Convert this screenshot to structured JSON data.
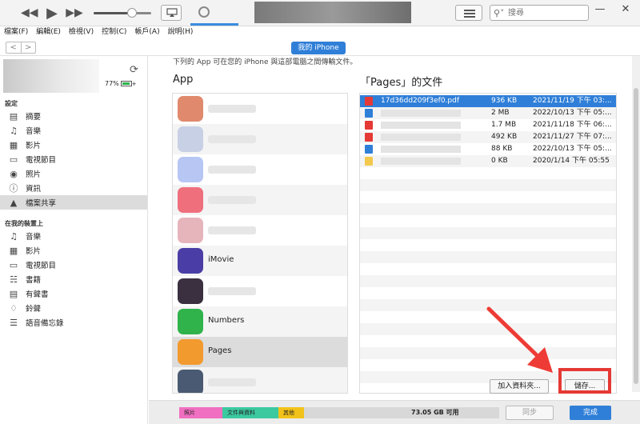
{
  "menu": [
    "檔案(F)",
    "編輯(E)",
    "檢視(V)",
    "控制(C)",
    "帳戶(A)",
    "說明(H)"
  ],
  "search": {
    "placeholder": "搜尋"
  },
  "device": {
    "pill_label": "我的 iPhone",
    "battery": "77%"
  },
  "sidebar": {
    "settings_title": "設定",
    "settings_items": [
      {
        "label": "摘要",
        "icon": "summary-icon"
      },
      {
        "label": "音樂",
        "icon": "music-icon"
      },
      {
        "label": "影片",
        "icon": "film-icon"
      },
      {
        "label": "電視節目",
        "icon": "tv-icon"
      },
      {
        "label": "照片",
        "icon": "camera-icon"
      },
      {
        "label": "資訊",
        "icon": "info-icon"
      },
      {
        "label": "檔案共享",
        "icon": "file-sharing-icon",
        "active": true
      }
    ],
    "device_title": "在我的裝置上",
    "device_items": [
      {
        "label": "音樂",
        "icon": "music-icon"
      },
      {
        "label": "影片",
        "icon": "film-icon"
      },
      {
        "label": "電視節目",
        "icon": "tv-icon"
      },
      {
        "label": "書籍",
        "icon": "book-icon"
      },
      {
        "label": "有聲書",
        "icon": "audiobook-icon"
      },
      {
        "label": "鈴聲",
        "icon": "bell-icon"
      },
      {
        "label": "語音備忘錄",
        "icon": "voice-memo-icon"
      }
    ]
  },
  "main": {
    "intro": "下列的 App 可在您的 iPhone 與這部電腦之間傳輸文件。",
    "app_header": "App",
    "docs_header": "「Pages」的文件",
    "apps": [
      {
        "name": "",
        "color": "#e0896c"
      },
      {
        "name": "",
        "color": "#c8d0e6"
      },
      {
        "name": "",
        "color": "#b7c6f2"
      },
      {
        "name": "",
        "color": "#ef6f7d"
      },
      {
        "name": "",
        "color": "#e5b5bb"
      },
      {
        "name": "iMovie",
        "color": "#4a3ea6"
      },
      {
        "name": "",
        "color": "#3a3040"
      },
      {
        "name": "Numbers",
        "color": "#2fb34a"
      },
      {
        "name": "Pages",
        "color": "#f29a2e",
        "selected": true
      },
      {
        "name": "",
        "color": "#4a5a72"
      }
    ],
    "docs": [
      {
        "name": "17d36dd209f3ef0.pdf",
        "size": "936 KB",
        "date": "2021/11/19 下午 03:...",
        "type": "pdf",
        "selected": true
      },
      {
        "name": "",
        "size": "2 MB",
        "date": "2022/10/13 下午 05:...",
        "type": "doc"
      },
      {
        "name": "",
        "size": "1.7 MB",
        "date": "2021/11/18 下午 06:...",
        "type": "pdf"
      },
      {
        "name": "",
        "size": "492 KB",
        "date": "2021/11/27 下午 07:...",
        "type": "pdf"
      },
      {
        "name": "",
        "size": "88 KB",
        "date": "2022/10/13 下午 05:...",
        "type": "doc"
      },
      {
        "name": "",
        "size": "0 KB",
        "date": "2020/1/14 下午 05:55",
        "type": "folder"
      }
    ],
    "add_folder_label": "加入資料夾...",
    "save_label": "儲存..."
  },
  "bottom": {
    "segments": [
      {
        "label": "照片",
        "color": "#f06fc0",
        "fraction": 0.135
      },
      {
        "label": "文件與資料",
        "color": "#3cc9a0",
        "fraction": 0.175
      },
      {
        "label": "其他",
        "color": "#f2c21a",
        "fraction": 0.08
      }
    ],
    "free_label": "73.05 GB 可用",
    "sync_label": "同步",
    "done_label": "完成"
  }
}
